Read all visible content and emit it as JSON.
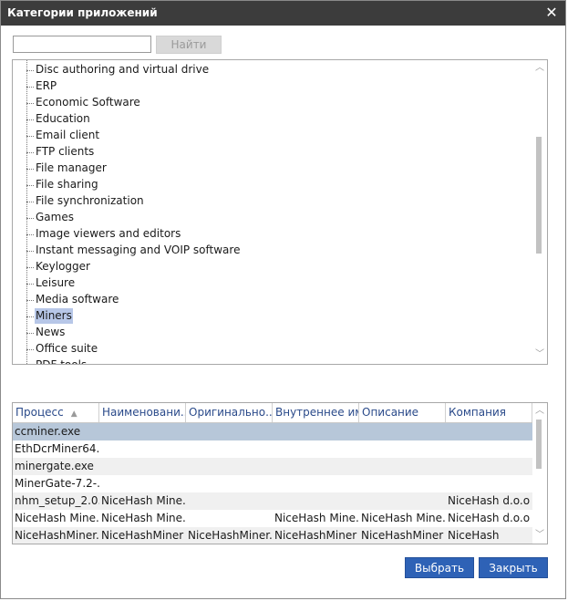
{
  "window": {
    "title": "Категории приложений",
    "close_symbol": "✕"
  },
  "search": {
    "placeholder": "",
    "value": "",
    "button_label": "Найти"
  },
  "tree": {
    "items": [
      "Disc authoring and virtual drive",
      "ERP",
      "Economic Software",
      "Education",
      "Email client",
      "FTP clients",
      "File manager",
      "File sharing",
      "File synchronization",
      "Games",
      "Image viewers and editors",
      "Instant messaging and VOIP software",
      "Keylogger",
      "Leisure",
      "Media software",
      "Miners",
      "News",
      "Office suite",
      "PDF tools"
    ],
    "selected": "Miners"
  },
  "table": {
    "columns": [
      "Процесс",
      "Наименовани...",
      "Оригинально...",
      "Внутреннее имя",
      "Описание",
      "Компания"
    ],
    "sort_column": "Процесс",
    "rows": [
      [
        "ccminer.exe",
        "",
        "",
        "",
        "",
        ""
      ],
      [
        "EthDcrMiner64....",
        "",
        "",
        "",
        "",
        ""
      ],
      [
        "minergate.exe",
        "",
        "",
        "",
        "",
        ""
      ],
      [
        "MinerGate-7.2-...",
        "",
        "",
        "",
        "",
        ""
      ],
      [
        "nhm_setup_2.0....",
        "NiceHash Mine...",
        "",
        "",
        "",
        "NiceHash d.o.o"
      ],
      [
        "NiceHash Mine...",
        "NiceHash Mine...",
        "",
        "NiceHash Mine...",
        "NiceHash Mine...",
        "NiceHash d.o.o"
      ],
      [
        "NiceHashMiner....",
        "NiceHashMiner",
        "NiceHashMiner....",
        "NiceHashMiner",
        "NiceHashMiner",
        "NiceHash"
      ]
    ]
  },
  "buttons": {
    "select_label": "Выбрать",
    "close_label": "Закрыть"
  },
  "colors": {
    "titlebar": "#3c3c3c",
    "accent": "#2e62b6",
    "selection": "#b7c7e8"
  }
}
